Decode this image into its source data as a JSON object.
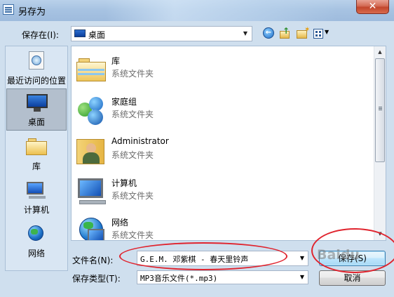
{
  "window": {
    "title": "另存为",
    "close_glyph": "✕"
  },
  "toolbar": {
    "save_in_label": "保存在(I):",
    "save_in_value": "桌面",
    "back_icon": "back-arrow-icon",
    "up_icon": "up-folder-icon",
    "new_folder_icon": "new-folder-icon",
    "view_icon": "view-menu-icon"
  },
  "places": [
    {
      "label": "最近访问的位置",
      "icon": "recent-places-icon",
      "selected": false
    },
    {
      "label": "桌面",
      "icon": "desktop-icon",
      "selected": true
    },
    {
      "label": "库",
      "icon": "libraries-icon",
      "selected": false
    },
    {
      "label": "计算机",
      "icon": "computer-icon",
      "selected": false
    },
    {
      "label": "网络",
      "icon": "network-icon",
      "selected": false
    }
  ],
  "files": [
    {
      "name": "库",
      "type": "系统文件夹",
      "icon": "library-folder-icon"
    },
    {
      "name": "家庭组",
      "type": "系统文件夹",
      "icon": "homegroup-icon"
    },
    {
      "name": "Administrator",
      "type": "系统文件夹",
      "icon": "user-folder-icon"
    },
    {
      "name": "计算机",
      "type": "系统文件夹",
      "icon": "computer-icon"
    },
    {
      "name": "网络",
      "type": "系统文件夹",
      "icon": "network-icon"
    }
  ],
  "form": {
    "filename_label": "文件名(N):",
    "filename_value": "G.E.M. 邓紫棋 - 春天里铃声",
    "filetype_label": "保存类型(T):",
    "filetype_value": "MP3音乐文件(*.mp3)"
  },
  "buttons": {
    "save": "保存(S)",
    "cancel": "取消"
  },
  "watermark": "Baidu",
  "colors": {
    "accent_ring": "#e0242e",
    "selected_place": "#b3bfcd"
  }
}
